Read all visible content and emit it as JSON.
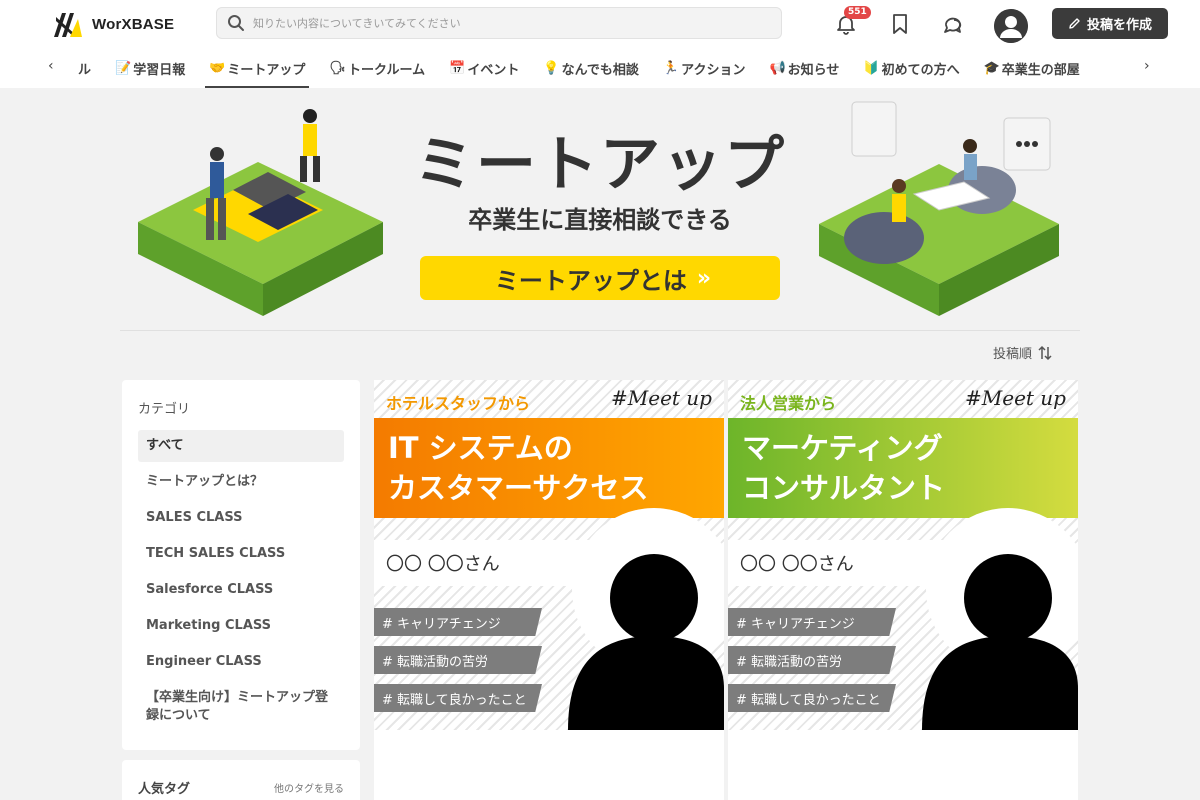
{
  "header": {
    "logo_text": "WorXBASE",
    "search_placeholder": "知りたい内容についてきいてみてください",
    "notifications_count": "551",
    "post_button_label": "投稿を作成"
  },
  "nav": {
    "prev_arrow": "‹",
    "next_arrow": "›",
    "items": [
      {
        "label": "ル",
        "emoji": ""
      },
      {
        "label": "学習日報",
        "emoji": "📝"
      },
      {
        "label": "ミートアップ",
        "emoji": "🤝"
      },
      {
        "label": "トークルーム",
        "emoji": "🗣"
      },
      {
        "label": "イベント",
        "emoji": "📅"
      },
      {
        "label": "なんでも相談",
        "emoji": "💡"
      },
      {
        "label": "アクション",
        "emoji": "🏃"
      },
      {
        "label": "お知らせ",
        "emoji": "📢"
      },
      {
        "label": "初めての方へ",
        "emoji": "🔰"
      },
      {
        "label": "卒業生の部屋",
        "emoji": "🎓"
      }
    ],
    "active_index": 2
  },
  "hero": {
    "title": "ミートアップ",
    "subtitle": "卒業生に直接相談できる",
    "button_label": "ミートアップとは"
  },
  "sort": {
    "label": "投稿順"
  },
  "sidebar": {
    "title": "カテゴリ",
    "items": [
      "すべて",
      "ミートアップとは？",
      "SALES CLASS",
      "TECH SALES CLASS",
      "Salesforce CLASS",
      "Marketing CLASS",
      "Engineer CLASS",
      "【卒業生向け】ミートアップ登録について"
    ],
    "selected_index": 0,
    "tags_title": "人気タグ",
    "tags_more": "他のタグを見る"
  },
  "cards": [
    {
      "origin": "ホテルスタッフから",
      "meetup": "#Meet up",
      "title_line1": "IT システムの",
      "title_line2": "カスタマーサクセス",
      "name": "〇〇 〇〇さん",
      "tags": [
        "# キャリアチェンジ",
        "# 転職活動の苦労",
        "# 転職して良かったこと"
      ],
      "origin_color": "#f39800",
      "gradient_from": "#f47b00",
      "gradient_to": "#ffa600"
    },
    {
      "origin": "法人営業から",
      "meetup": "#Meet up",
      "title_line1": "マーケティング",
      "title_line2": "コンサルタント",
      "name": "〇〇 〇〇さん",
      "tags": [
        "# キャリアチェンジ",
        "# 転職活動の苦労",
        "# 転職して良かったこと"
      ],
      "origin_color": "#7ab51d",
      "gradient_from": "#6db52a",
      "gradient_to": "#d4dc3f"
    }
  ],
  "colors": {
    "accent_yellow": "#ffd800",
    "badge_red": "#e34646",
    "dark_button": "#3b3b3b"
  }
}
